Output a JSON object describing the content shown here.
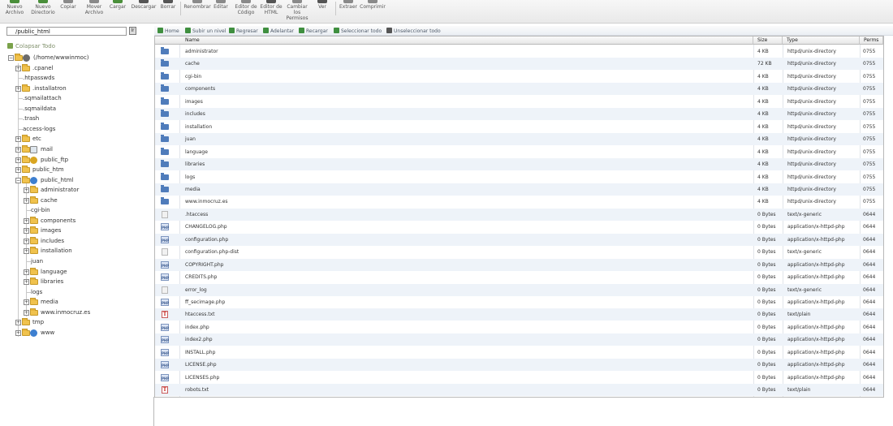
{
  "toolbar": {
    "buttons": [
      {
        "label": "Nuevo\nArchivo",
        "icon": "new-file-icon",
        "color": "#4a8f3a"
      },
      {
        "label": "Nuevo\nDirectorio",
        "icon": "new-folder-icon",
        "color": "#4a8f3a"
      },
      {
        "label": "Copiar",
        "icon": "copy-icon",
        "color": "#8a8a8a"
      },
      {
        "label": "Mover\nArchivo",
        "icon": "move-icon",
        "color": "#8a8a8a"
      },
      {
        "label": "Cargar",
        "icon": "upload-icon",
        "color": "#4a8f3a"
      },
      {
        "label": "Descargar",
        "icon": "download-icon",
        "color": "#555555"
      },
      {
        "label": "Borrar",
        "icon": "delete-icon",
        "color": "#555555"
      },
      {
        "label": "Renombrar",
        "icon": "rename-icon",
        "color": "#8a8a8a"
      },
      {
        "label": "Editar",
        "icon": "edit-icon",
        "color": "#8a8a8a"
      },
      {
        "label": "Editor de\nCódigo",
        "icon": "code-editor-icon",
        "color": "#8a8a8a"
      },
      {
        "label": "Editor de\nHTML",
        "icon": "html-editor-icon",
        "color": "#555555"
      },
      {
        "label": "Cambiar\nlos\nPermisos",
        "icon": "permissions-icon",
        "color": "#8a8a8a"
      },
      {
        "label": "Ver",
        "icon": "view-icon",
        "color": "#555555"
      },
      {
        "label": "Extraer",
        "icon": "extract-icon",
        "color": "#8a8a8a"
      },
      {
        "label": "Comprimir",
        "icon": "compress-icon",
        "color": "#8a8a8a"
      }
    ]
  },
  "path_bar": {
    "value": "/public_html",
    "go_label": "Ir"
  },
  "tree": {
    "collapse_label": "Colapsar Todo",
    "items": [
      {
        "label": "(/home/wwwinmoc)",
        "depth": 0,
        "expander": "-",
        "kind": "home"
      },
      {
        "label": ".cpanel",
        "depth": 1,
        "expander": "+",
        "kind": "folder"
      },
      {
        "label": ".htpasswds",
        "depth": 1,
        "expander": "",
        "kind": "plain"
      },
      {
        "label": ".installatron",
        "depth": 1,
        "expander": "+",
        "kind": "folder"
      },
      {
        "label": ".sqmailattach",
        "depth": 1,
        "expander": "",
        "kind": "plain"
      },
      {
        "label": ".sqmaildata",
        "depth": 1,
        "expander": "",
        "kind": "plain"
      },
      {
        "label": ".trash",
        "depth": 1,
        "expander": "",
        "kind": "plain"
      },
      {
        "label": "access-logs",
        "depth": 1,
        "expander": "",
        "kind": "plain"
      },
      {
        "label": "etc",
        "depth": 1,
        "expander": "+",
        "kind": "folder"
      },
      {
        "label": "mail",
        "depth": 1,
        "expander": "+",
        "kind": "mail"
      },
      {
        "label": "public_ftp",
        "depth": 1,
        "expander": "+",
        "kind": "ftp"
      },
      {
        "label": "public_htm",
        "depth": 1,
        "expander": "+",
        "kind": "folder"
      },
      {
        "label": "public_html",
        "depth": 1,
        "expander": "-",
        "kind": "web"
      },
      {
        "label": "administrator",
        "depth": 2,
        "expander": "+",
        "kind": "folder"
      },
      {
        "label": "cache",
        "depth": 2,
        "expander": "+",
        "kind": "folder"
      },
      {
        "label": "cgi-bin",
        "depth": 2,
        "expander": "",
        "kind": "plain"
      },
      {
        "label": "components",
        "depth": 2,
        "expander": "+",
        "kind": "folder"
      },
      {
        "label": "images",
        "depth": 2,
        "expander": "+",
        "kind": "folder"
      },
      {
        "label": "includes",
        "depth": 2,
        "expander": "+",
        "kind": "folder"
      },
      {
        "label": "installation",
        "depth": 2,
        "expander": "+",
        "kind": "folder"
      },
      {
        "label": "juan",
        "depth": 2,
        "expander": "",
        "kind": "plain"
      },
      {
        "label": "language",
        "depth": 2,
        "expander": "+",
        "kind": "folder"
      },
      {
        "label": "libraries",
        "depth": 2,
        "expander": "+",
        "kind": "folder"
      },
      {
        "label": "logs",
        "depth": 2,
        "expander": "",
        "kind": "plain"
      },
      {
        "label": "media",
        "depth": 2,
        "expander": "+",
        "kind": "folder"
      },
      {
        "label": "www.inmocruz.es",
        "depth": 2,
        "expander": "+",
        "kind": "folder"
      },
      {
        "label": "tmp",
        "depth": 1,
        "expander": "+",
        "kind": "folder"
      },
      {
        "label": "www",
        "depth": 1,
        "expander": "+",
        "kind": "web"
      }
    ]
  },
  "nav": {
    "items": [
      {
        "label": "Home",
        "icon": "home-icon",
        "color": "#3f8f3f"
      },
      {
        "label": "Subir un nivel",
        "icon": "up-level-icon",
        "color": "#3f8f3f"
      },
      {
        "label": "Regresar",
        "icon": "back-icon",
        "color": "#3f8f3f"
      },
      {
        "label": "Adelantar",
        "icon": "forward-icon",
        "color": "#3f8f3f"
      },
      {
        "label": "Recargar",
        "icon": "reload-icon",
        "color": "#3f8f3f"
      },
      {
        "label": "Seleccionar todo",
        "icon": "select-all-icon",
        "color": "#3f8f3f"
      },
      {
        "label": "Unseleccionar todo",
        "icon": "unselect-all-icon",
        "color": "#555555"
      }
    ]
  },
  "file_table": {
    "columns": [
      "Name",
      "Size",
      "Type",
      "Perms"
    ],
    "rows": [
      {
        "name": "administrator",
        "size": "4 KB",
        "type": "httpd/unix-directory",
        "perms": "0755",
        "icon": "dir"
      },
      {
        "name": "cache",
        "size": "72 KB",
        "type": "httpd/unix-directory",
        "perms": "0755",
        "icon": "dir"
      },
      {
        "name": "cgi-bin",
        "size": "4 KB",
        "type": "httpd/unix-directory",
        "perms": "0755",
        "icon": "dir"
      },
      {
        "name": "components",
        "size": "4 KB",
        "type": "httpd/unix-directory",
        "perms": "0755",
        "icon": "dir"
      },
      {
        "name": "images",
        "size": "4 KB",
        "type": "httpd/unix-directory",
        "perms": "0755",
        "icon": "dir"
      },
      {
        "name": "includes",
        "size": "4 KB",
        "type": "httpd/unix-directory",
        "perms": "0755",
        "icon": "dir"
      },
      {
        "name": "installation",
        "size": "4 KB",
        "type": "httpd/unix-directory",
        "perms": "0755",
        "icon": "dir"
      },
      {
        "name": "juan",
        "size": "4 KB",
        "type": "httpd/unix-directory",
        "perms": "0755",
        "icon": "dir"
      },
      {
        "name": "language",
        "size": "4 KB",
        "type": "httpd/unix-directory",
        "perms": "0755",
        "icon": "dir"
      },
      {
        "name": "libraries",
        "size": "4 KB",
        "type": "httpd/unix-directory",
        "perms": "0755",
        "icon": "dir"
      },
      {
        "name": "logs",
        "size": "4 KB",
        "type": "httpd/unix-directory",
        "perms": "0755",
        "icon": "dir"
      },
      {
        "name": "media",
        "size": "4 KB",
        "type": "httpd/unix-directory",
        "perms": "0755",
        "icon": "dir"
      },
      {
        "name": "www.inmocruz.es",
        "size": "4 KB",
        "type": "httpd/unix-directory",
        "perms": "0755",
        "icon": "dir"
      },
      {
        "name": ".htaccess",
        "size": "0 Bytes",
        "type": "text/x-generic",
        "perms": "0644",
        "icon": "gen"
      },
      {
        "name": "CHANGELOG.php",
        "size": "0 Bytes",
        "type": "application/x-httpd-php",
        "perms": "0644",
        "icon": "php"
      },
      {
        "name": "configuration.php",
        "size": "0 Bytes",
        "type": "application/x-httpd-php",
        "perms": "0644",
        "icon": "php"
      },
      {
        "name": "configuration.php-dist",
        "size": "0 Bytes",
        "type": "text/x-generic",
        "perms": "0644",
        "icon": "gen"
      },
      {
        "name": "COPYRIGHT.php",
        "size": "0 Bytes",
        "type": "application/x-httpd-php",
        "perms": "0644",
        "icon": "php"
      },
      {
        "name": "CREDITS.php",
        "size": "0 Bytes",
        "type": "application/x-httpd-php",
        "perms": "0644",
        "icon": "php"
      },
      {
        "name": "error_log",
        "size": "0 Bytes",
        "type": "text/x-generic",
        "perms": "0644",
        "icon": "gen"
      },
      {
        "name": "ff_secimage.php",
        "size": "0 Bytes",
        "type": "application/x-httpd-php",
        "perms": "0644",
        "icon": "php"
      },
      {
        "name": "htaccess.txt",
        "size": "0 Bytes",
        "type": "text/plain",
        "perms": "0644",
        "icon": "txt"
      },
      {
        "name": "index.php",
        "size": "0 Bytes",
        "type": "application/x-httpd-php",
        "perms": "0644",
        "icon": "php"
      },
      {
        "name": "index2.php",
        "size": "0 Bytes",
        "type": "application/x-httpd-php",
        "perms": "0644",
        "icon": "php"
      },
      {
        "name": "INSTALL.php",
        "size": "0 Bytes",
        "type": "application/x-httpd-php",
        "perms": "0644",
        "icon": "php"
      },
      {
        "name": "LICENSE.php",
        "size": "0 Bytes",
        "type": "application/x-httpd-php",
        "perms": "0644",
        "icon": "php"
      },
      {
        "name": "LICENSES.php",
        "size": "0 Bytes",
        "type": "application/x-httpd-php",
        "perms": "0644",
        "icon": "php"
      },
      {
        "name": "robots.txt",
        "size": "0 Bytes",
        "type": "text/plain",
        "perms": "0644",
        "icon": "txt"
      }
    ]
  }
}
